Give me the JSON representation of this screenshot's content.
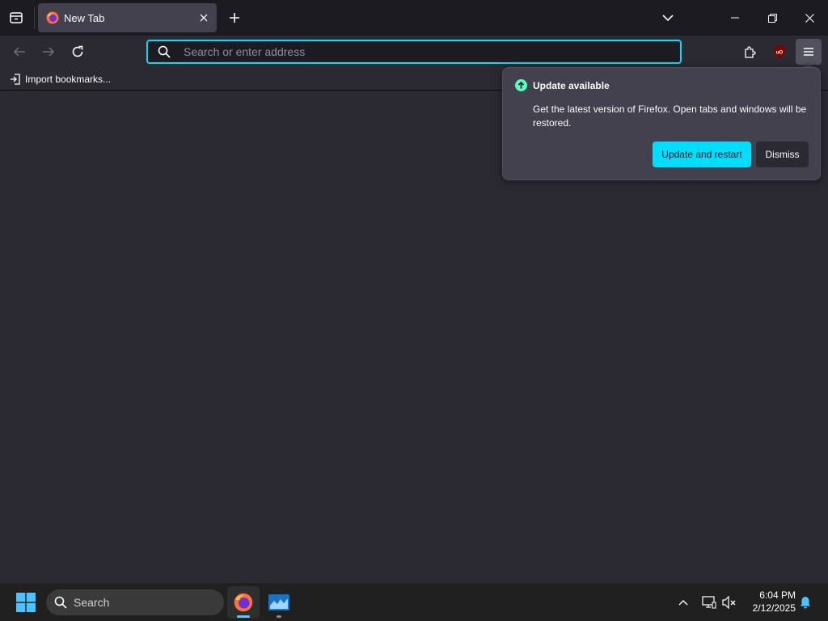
{
  "browser": {
    "tab": {
      "title": "New Tab"
    },
    "urlbar": {
      "placeholder": "Search or enter address",
      "value": ""
    },
    "bookmarks": {
      "import_label": "Import bookmarks..."
    },
    "extensions": {
      "ublock_badge": "uO"
    }
  },
  "update_popup": {
    "title": "Update available",
    "body": "Get the latest version of Firefox. Open tabs and windows will be restored.",
    "primary_button": "Update and restart",
    "secondary_button": "Dismiss"
  },
  "taskbar": {
    "search_label": "Search",
    "clock_time": "6:04 PM",
    "clock_date": "2/12/2025"
  },
  "colors": {
    "accent": "#00ddff",
    "update_icon": "#54ffbd",
    "background": "#2b2a33",
    "tabstrip": "#1c1b22",
    "popup": "#42414d"
  },
  "icons": [
    "tab-list-icon",
    "firefox-logo-icon",
    "close-icon",
    "plus-icon",
    "chevron-down-icon",
    "minimize-icon",
    "restore-icon",
    "window-close-icon",
    "back-arrow-icon",
    "forward-arrow-icon",
    "reload-icon",
    "search-icon",
    "extensions-icon",
    "ublock-icon",
    "hamburger-menu-icon",
    "import-icon",
    "update-arrow-icon",
    "windows-start-icon",
    "chevron-up-icon",
    "network-icon",
    "volume-muted-icon",
    "notification-bell-icon"
  ]
}
